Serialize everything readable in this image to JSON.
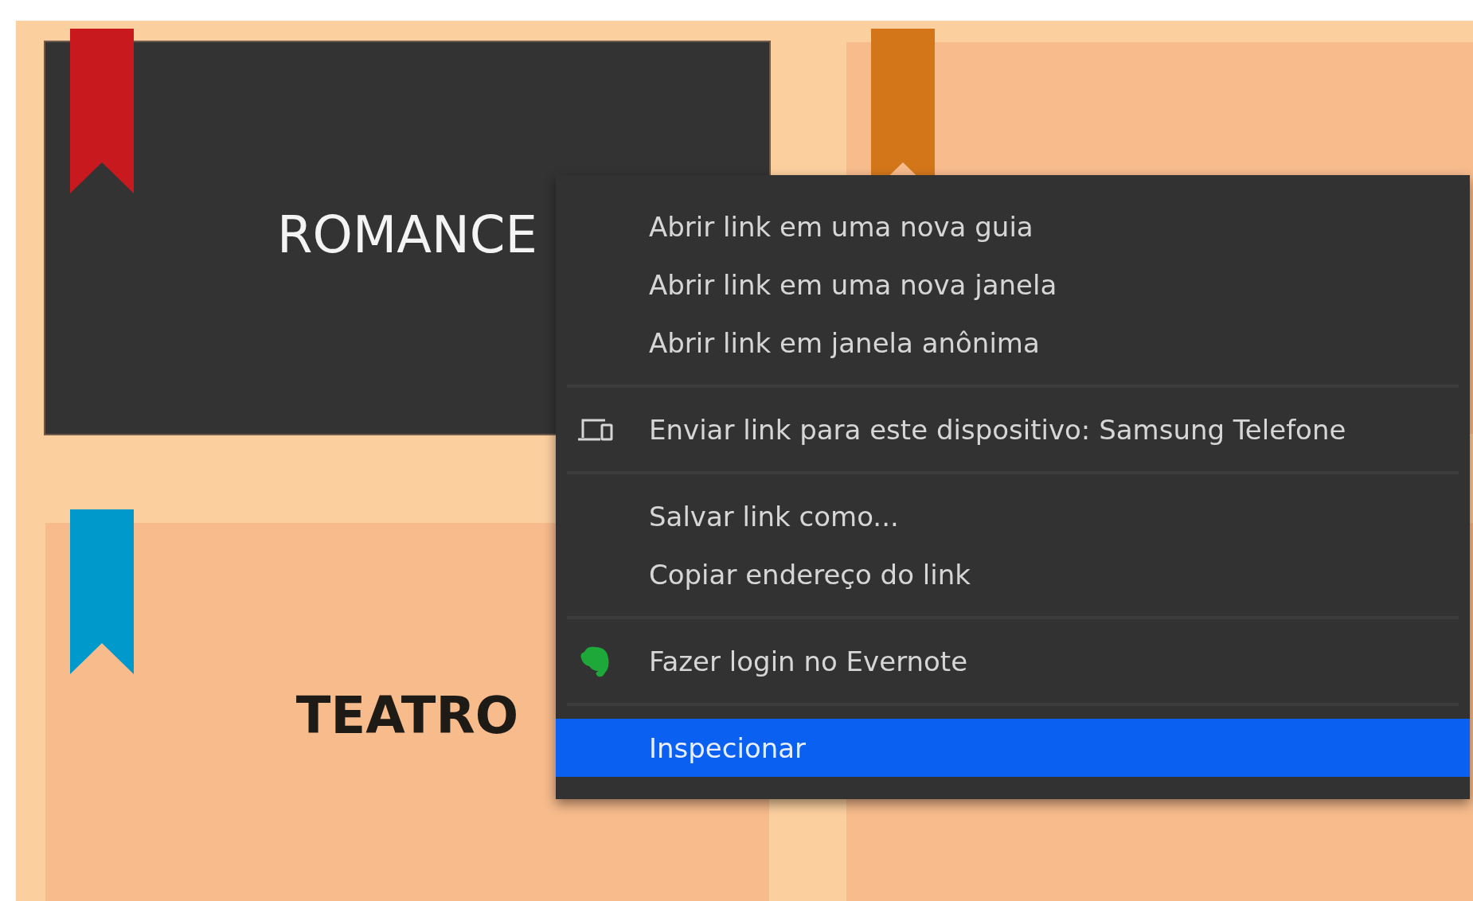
{
  "cards": [
    {
      "label": "ROMANCE",
      "kind": "dark",
      "color": "#c8191e"
    },
    {
      "kind": "light",
      "color": "#d3761a"
    },
    {
      "label": "TEATRO",
      "kind": "light",
      "color": "#0099cc"
    },
    {
      "kind": "light"
    }
  ],
  "context_menu": {
    "groups": [
      [
        {
          "label": "Abrir link em uma nova guia",
          "kind": "text",
          "selected": false
        },
        {
          "label": "Abrir link em uma nova janela",
          "kind": "text",
          "selected": false
        },
        {
          "label": "Abrir link em janela anônima",
          "kind": "text",
          "selected": false
        }
      ],
      [
        {
          "label": "Enviar link para este dispositivo: Samsung Telefone",
          "kind": "device",
          "selected": false
        }
      ],
      [
        {
          "label": "Salvar link como...",
          "kind": "text",
          "selected": false
        },
        {
          "label": "Copiar endereço do link",
          "kind": "text",
          "selected": false
        }
      ],
      [
        {
          "label": "Fazer login no Evernote",
          "kind": "app",
          "selected": false
        }
      ],
      [
        {
          "label": "Inspecionar",
          "kind": "text",
          "selected": true
        }
      ]
    ]
  }
}
